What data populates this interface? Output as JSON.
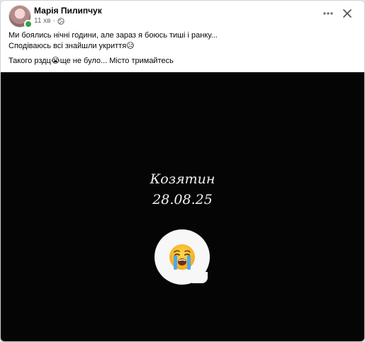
{
  "post": {
    "author": "Марія Пилипчук",
    "time": "11 хв",
    "separator": "·",
    "privacy_icon": "globe-icon",
    "more_icon": "more-horizontal-icon",
    "close_icon": "close-icon",
    "lines": [
      "Ми боялись нічні години, але зараз я боюсь тиші і ранку...",
      "Сподіваюсь всі знайшли укриття😥",
      "Такого рздц😭ще не було... Місто тримайтесь"
    ]
  },
  "media": {
    "city": "Козятин",
    "date": "28.08.25",
    "emoji": "😭",
    "background": "#050505"
  },
  "colors": {
    "online": "#31a24c",
    "meta_text": "#65676b"
  }
}
